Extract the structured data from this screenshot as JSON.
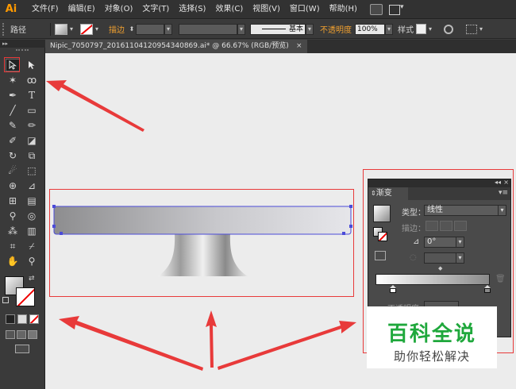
{
  "app": {
    "logo": "Ai"
  },
  "menu": {
    "items": [
      "文件(F)",
      "编辑(E)",
      "对象(O)",
      "文字(T)",
      "选择(S)",
      "效果(C)",
      "视图(V)",
      "窗口(W)",
      "帮助(H)"
    ]
  },
  "control_bar": {
    "selection_label": "路径",
    "stroke_label": "描边",
    "stroke_style": "基本",
    "opacity_label": "不透明度",
    "opacity_value": "100%",
    "style_label": "样式"
  },
  "document_tab": {
    "title": "Nipic_7050797_20161104120954340869.ai*  @ 66.67% (RGB/预览)",
    "close": "×"
  },
  "gradient_panel": {
    "title": "渐变",
    "type_label": "类型：",
    "type_value": "线性",
    "stroke_label": "描边：",
    "angle_value": "0°",
    "opacity_label": "不透明度"
  },
  "watermark": {
    "title": "百科全说",
    "subtitle": "助你轻松解决"
  },
  "colors": {
    "annotation_red": "#e83a3a",
    "ui_accent_orange": "#f0a030",
    "watermark_green": "#1fa83c"
  }
}
